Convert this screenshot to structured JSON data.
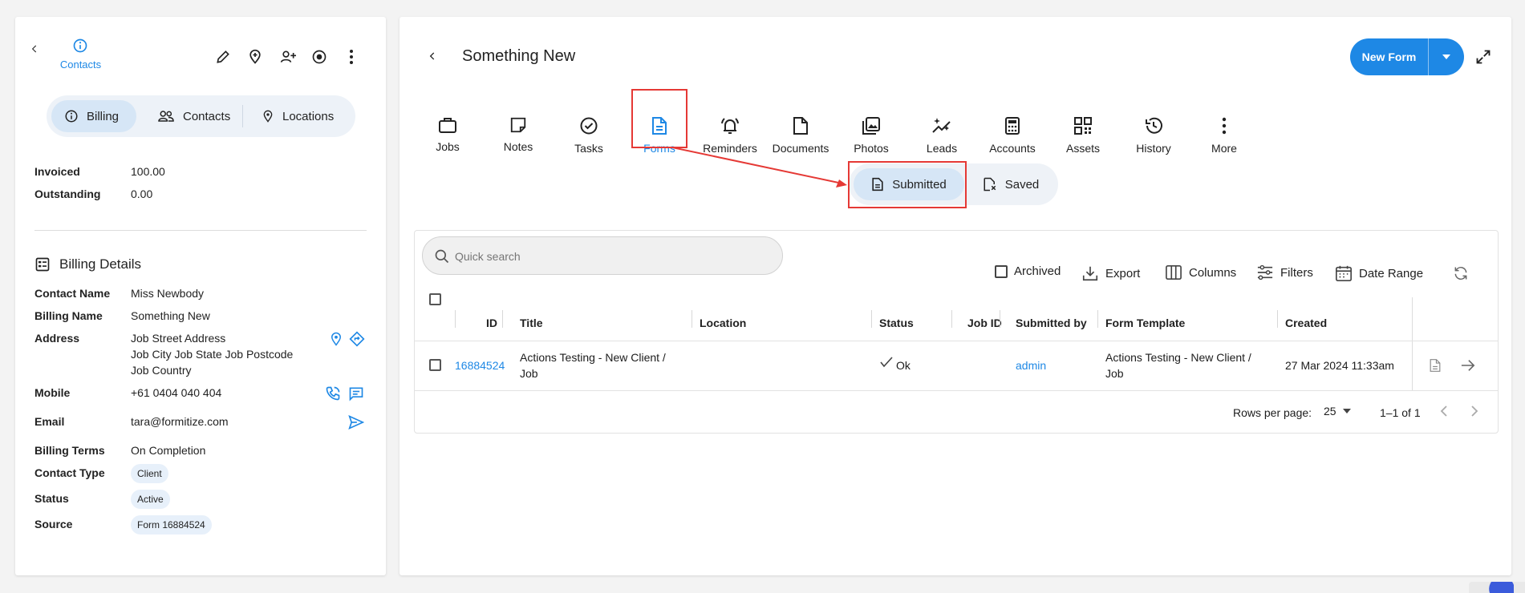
{
  "left": {
    "header_label": "Contacts",
    "segments": [
      "Billing",
      "Contacts",
      "Locations"
    ],
    "summary": [
      {
        "label": "Invoiced",
        "value": "100.00"
      },
      {
        "label": "Outstanding",
        "value": "0.00"
      }
    ],
    "billing_title": "Billing Details",
    "contact_name_label": "Contact Name",
    "contact_name": "Miss Newbody",
    "billing_name_label": "Billing Name",
    "billing_name": "Something New",
    "address_label": "Address",
    "address_lines": [
      "Job Street Address",
      "Job City Job State Job Postcode",
      "Job Country"
    ],
    "mobile_label": "Mobile",
    "mobile": "+61 0404 040 404",
    "email_label": "Email",
    "email": "tara@formitize.com",
    "billing_terms_label": "Billing Terms",
    "billing_terms": "On Completion",
    "contact_type_label": "Contact Type",
    "contact_type": "Client",
    "status_label": "Status",
    "status": "Active",
    "source_label": "Source",
    "source": "Form 16884524"
  },
  "right": {
    "title": "Something New",
    "new_form_label": "New Form",
    "tabs": [
      "Jobs",
      "Notes",
      "Tasks",
      "Forms",
      "Reminders",
      "Documents",
      "Photos",
      "Leads",
      "Accounts",
      "Assets",
      "History",
      "More"
    ],
    "active_tab": "Forms",
    "subtabs": [
      "Submitted",
      "Saved"
    ],
    "search_placeholder": "Quick search",
    "toolbar": {
      "archived": "Archived",
      "export": "Export",
      "columns": "Columns",
      "filters": "Filters",
      "date_range": "Date Range"
    },
    "columns": [
      "ID",
      "Title",
      "Location",
      "Status",
      "Job ID",
      "Submitted by",
      "Form Template",
      "Created"
    ],
    "rows": [
      {
        "id": "16884524",
        "title_line1": "Actions Testing - New Client /",
        "title_line2": "Job",
        "location": "",
        "status": "Ok",
        "job_id": "",
        "submitted_by": "admin",
        "template_line1": "Actions Testing - New Client /",
        "template_line2": "Job",
        "created": "27 Mar 2024 11:33am"
      }
    ],
    "pagination": {
      "rows_per_page_label": "Rows per page:",
      "rows_per_page": "25",
      "range": "1–1 of 1"
    }
  },
  "colors": {
    "accent": "#1e88e5",
    "highlight": "#e53935"
  }
}
